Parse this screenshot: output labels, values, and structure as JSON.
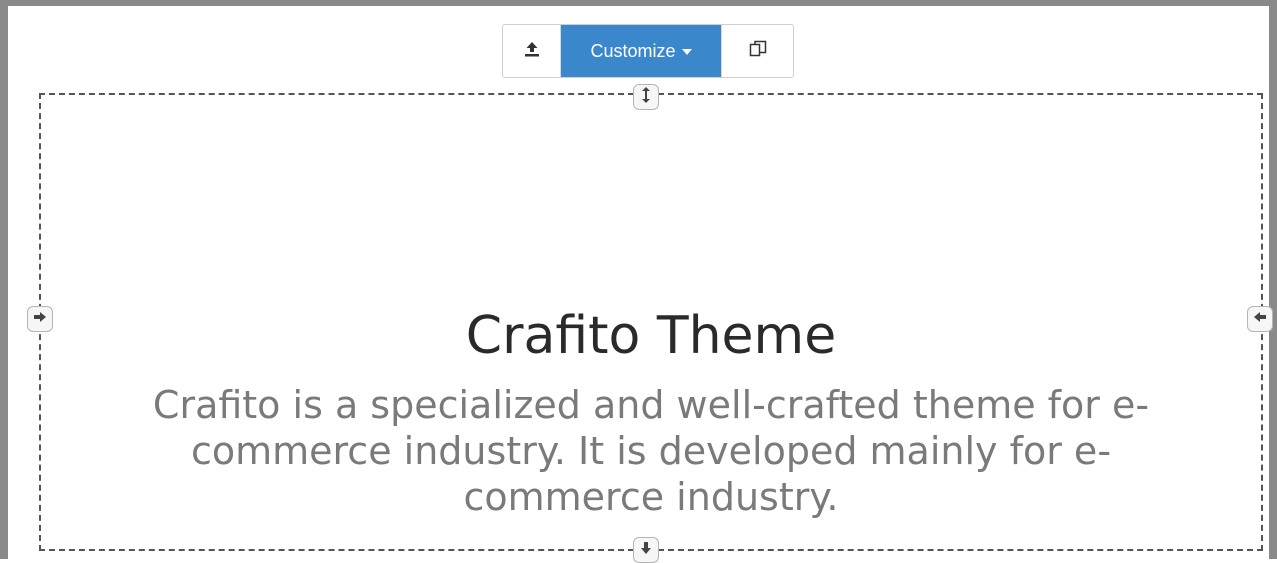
{
  "toolbar": {
    "upload_icon": "upload-icon",
    "customize_label": "Customize",
    "copy_icon": "copy-icon"
  },
  "handles": {
    "top": "resize-vertical-icon",
    "bottom": "arrow-down-icon",
    "left": "arrow-right-icon",
    "right": "arrow-left-icon"
  },
  "content": {
    "heading": "Crafito Theme",
    "description": "Crafito is a specialized and well-crafted theme for e-commerce industry. It is developed mainly for e-commerce industry."
  },
  "colors": {
    "accent": "#3a87cc",
    "heading": "#2a2a2a",
    "description": "#7a7a7a"
  }
}
